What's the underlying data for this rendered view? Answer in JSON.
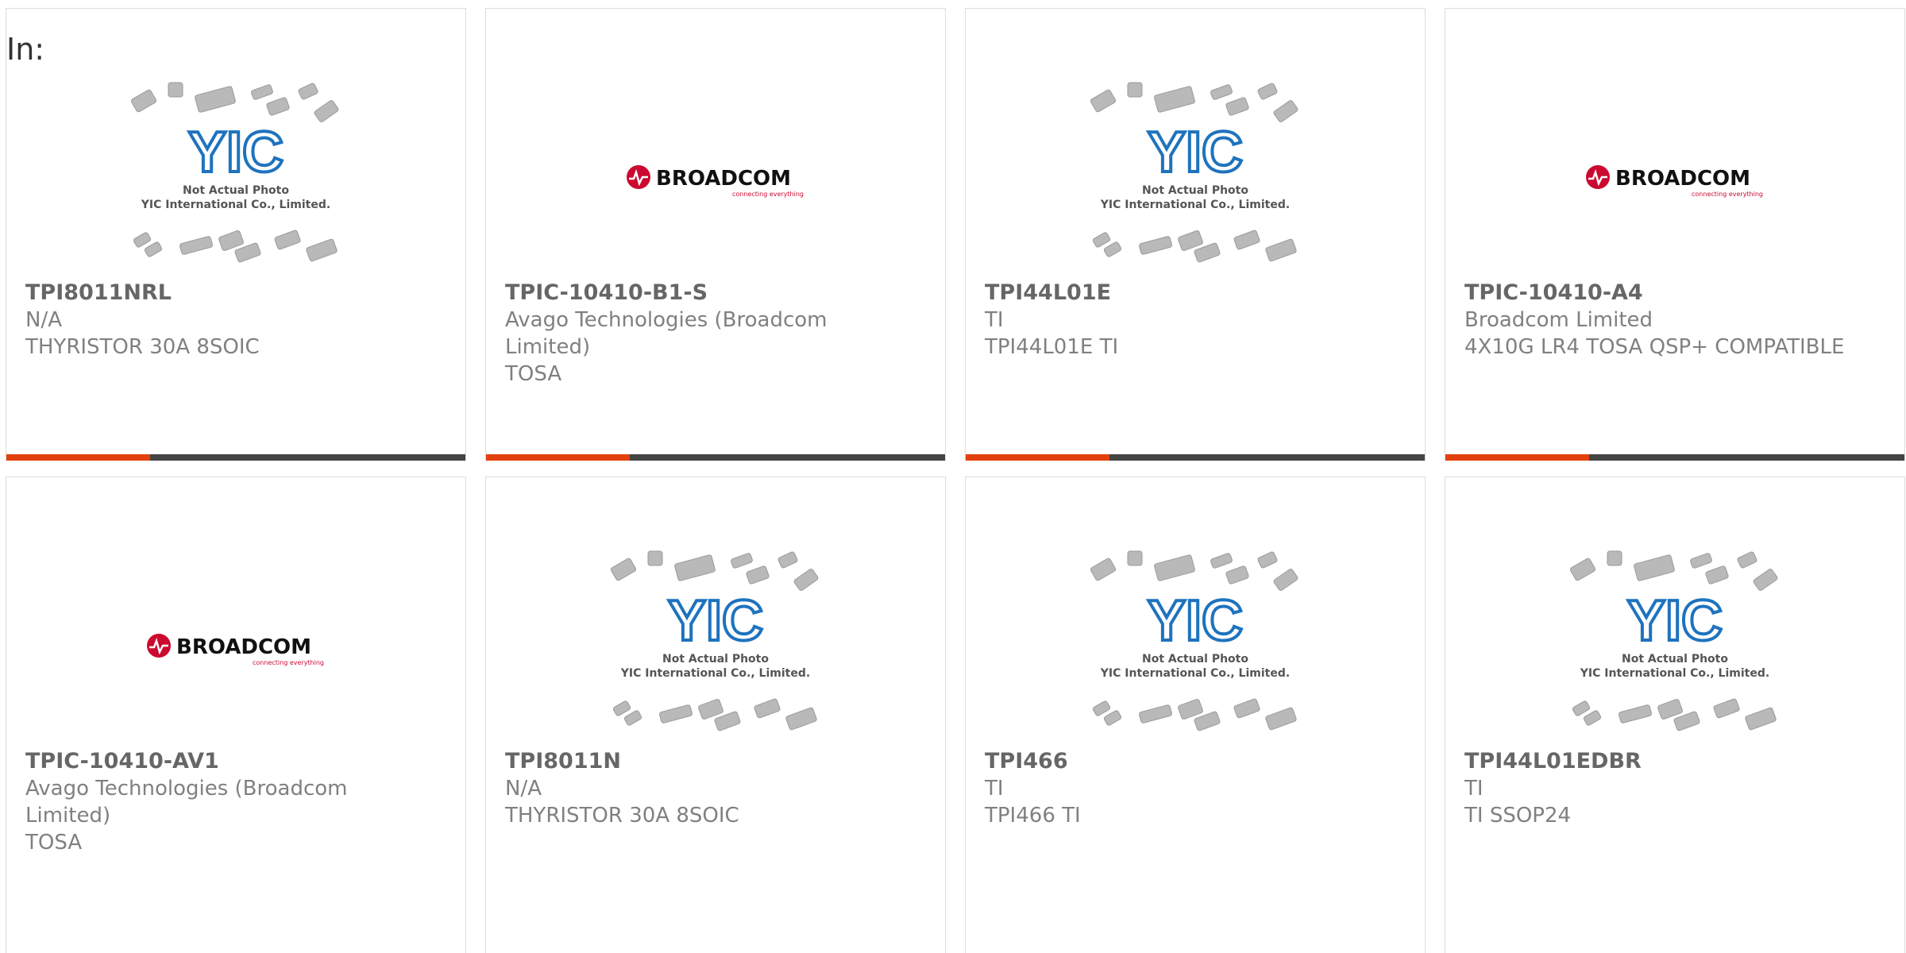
{
  "filter_label": "In:",
  "brand_colors": {
    "accent": "#e2410f",
    "dark_bar": "#444444",
    "yic_blue": "#1e73be",
    "broadcom_red": "#cc092f"
  },
  "yic_placeholder": {
    "line1": "Not Actual Photo",
    "line2": "YIC International Co., Limited.",
    "mark": "YIC"
  },
  "broadcom_logo": {
    "name": "BROADCOM",
    "tagline": "connecting everything"
  },
  "products": [
    {
      "part_number": "TPI8011NRL",
      "manufacturer": "N/A",
      "description": "THYRISTOR 30A 8SOIC",
      "image": "yic-placeholder"
    },
    {
      "part_number": "TPIC-10410-B1-S",
      "manufacturer": "Avago Technologies (Broadcom Limited)",
      "description": "TOSA",
      "image": "broadcom-logo"
    },
    {
      "part_number": "TPI44L01E",
      "manufacturer": "TI",
      "description": "TPI44L01E TI",
      "image": "yic-placeholder"
    },
    {
      "part_number": "TPIC-10410-A4",
      "manufacturer": "Broadcom Limited",
      "description": "4X10G LR4 TOSA QSP+ COMPATIBLE",
      "image": "broadcom-logo"
    },
    {
      "part_number": "TPIC-10410-AV1",
      "manufacturer": "Avago Technologies (Broadcom Limited)",
      "description": "TOSA",
      "image": "broadcom-logo"
    },
    {
      "part_number": "TPI8011N",
      "manufacturer": "N/A",
      "description": "THYRISTOR 30A 8SOIC",
      "image": "yic-placeholder"
    },
    {
      "part_number": "TPI466",
      "manufacturer": "TI",
      "description": "TPI466 TI",
      "image": "yic-placeholder"
    },
    {
      "part_number": "TPI44L01EDBR",
      "manufacturer": "TI",
      "description": "TI SSOP24",
      "image": "yic-placeholder"
    }
  ]
}
